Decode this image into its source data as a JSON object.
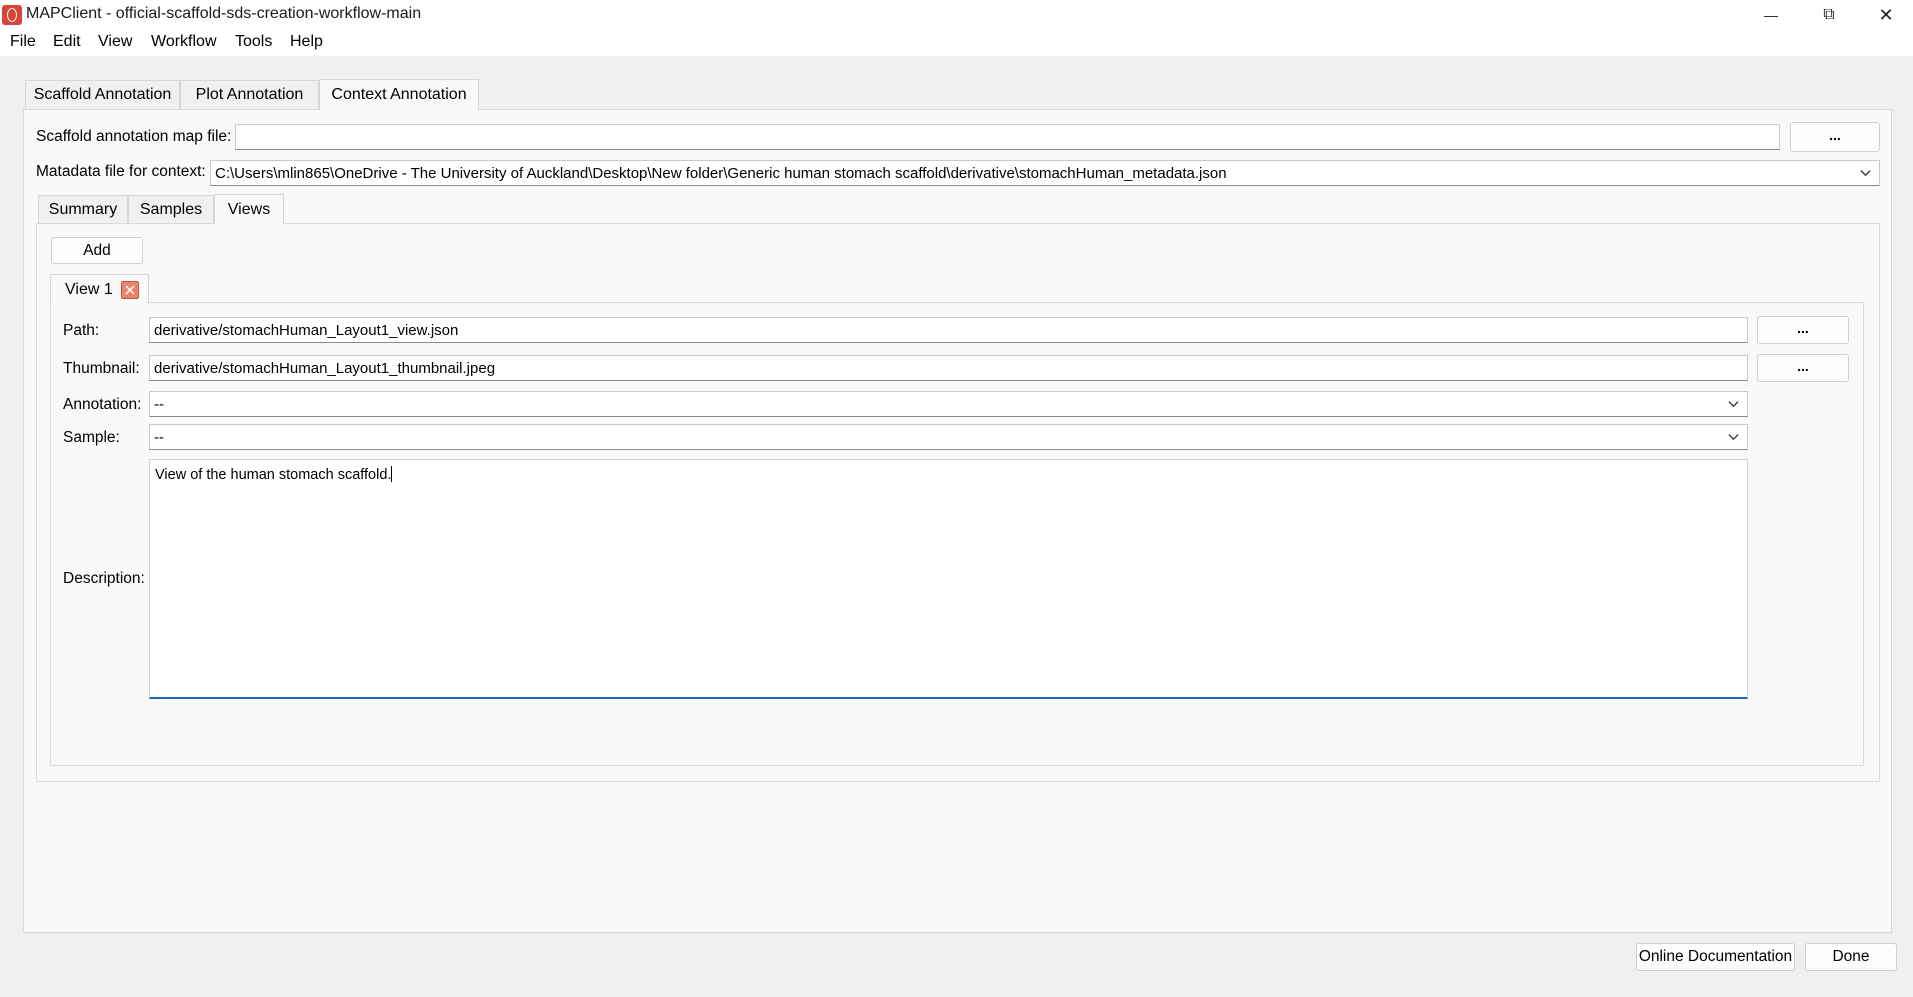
{
  "window": {
    "title": "MAPClient - official-scaffold-sds-creation-workflow-main",
    "minimize_glyph": "—",
    "maximize_glyph": "⧉",
    "close_glyph": "✕"
  },
  "menu": [
    "File",
    "Edit",
    "View",
    "Workflow",
    "Tools",
    "Help"
  ],
  "top_tabs": [
    {
      "label": "Scaffold Annotation",
      "active": false
    },
    {
      "label": "Plot Annotation",
      "active": false
    },
    {
      "label": "Context Annotation",
      "active": true
    }
  ],
  "context": {
    "map_file_label": "Scaffold annotation map file:",
    "map_file_value": "",
    "map_file_browse": "...",
    "metadata_label": "Matadata file for context:",
    "metadata_value": "C:\\Users\\mlin865\\OneDrive - The University of Auckland\\Desktop\\New folder\\Generic human stomach scaffold\\derivative\\stomachHuman_metadata.json"
  },
  "sub_tabs": [
    {
      "label": "Summary",
      "active": false
    },
    {
      "label": "Samples",
      "active": false
    },
    {
      "label": "Views",
      "active": true
    }
  ],
  "views": {
    "add_label": "Add",
    "view_tab_label": "View 1",
    "path_label": "Path:",
    "path_value": "derivative/stomachHuman_Layout1_view.json",
    "path_browse": "...",
    "thumbnail_label": "Thumbnail:",
    "thumbnail_value": "derivative/stomachHuman_Layout1_thumbnail.jpeg",
    "thumbnail_browse": "...",
    "annotation_label": "Annotation:",
    "annotation_value": "--",
    "sample_label": "Sample:",
    "sample_value": "--",
    "description_label": "Description:",
    "description_value": "View of the human stomach scaffold."
  },
  "footer": {
    "docs_label": "Online Documentation",
    "done_label": "Done"
  },
  "icons": {
    "app": "mapclient-app-icon",
    "close_view": "close-x-icon",
    "dropdown": "chevron-down-icon"
  },
  "colors": {
    "app_icon": "#d9443a",
    "close_view_icon": "#e8836e",
    "focus_underline": "#1f6db5"
  }
}
